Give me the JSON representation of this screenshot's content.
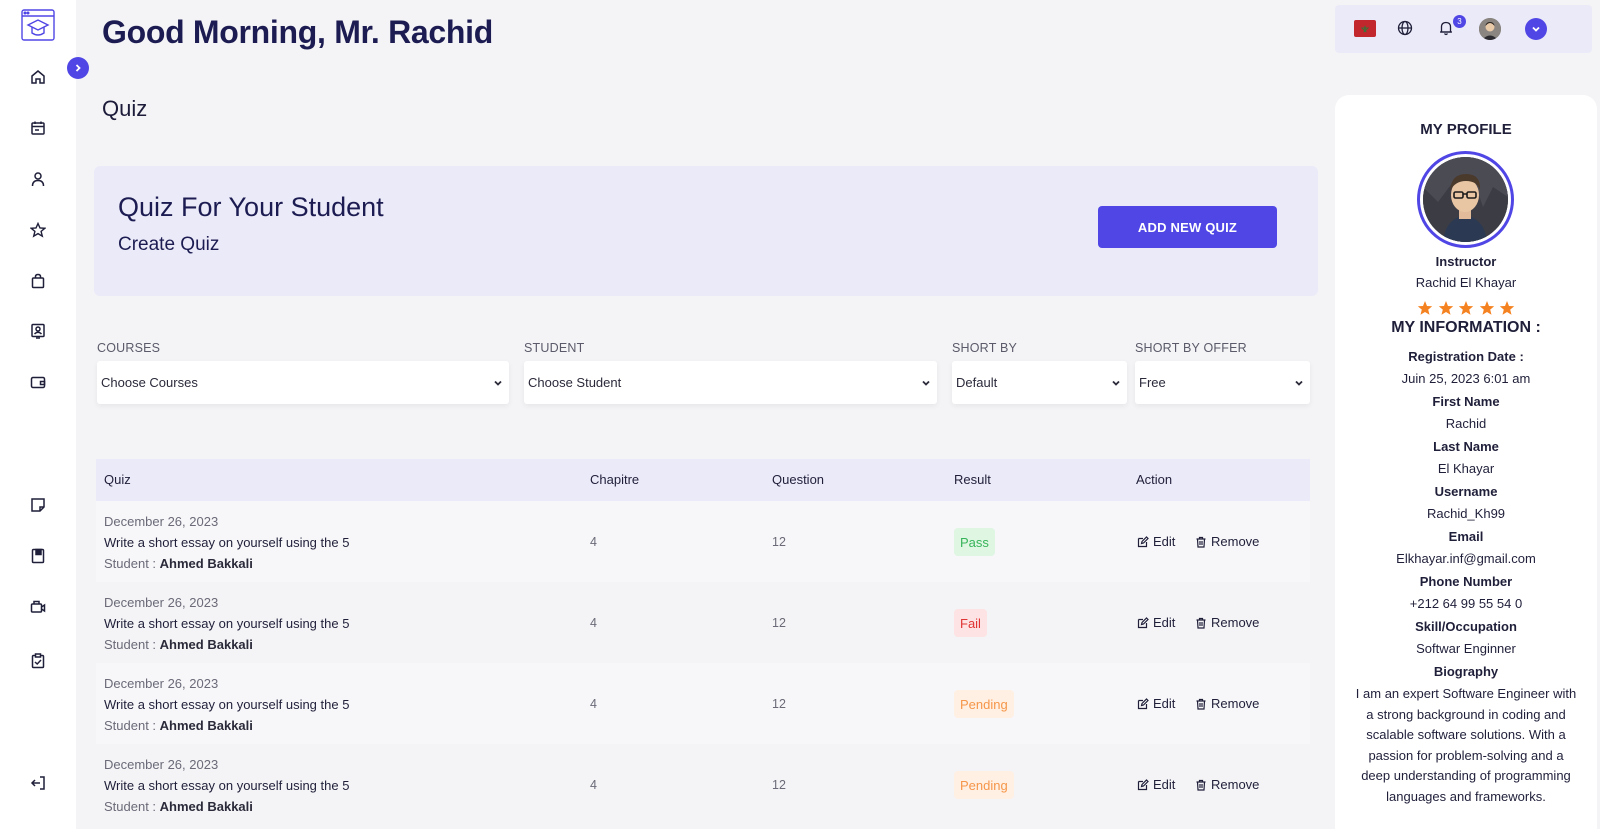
{
  "header": {
    "greeting": "Good Morning, Mr. Rachid",
    "page_title": "Quiz"
  },
  "sidebar": {
    "items": [
      {
        "icon": "home-icon"
      },
      {
        "icon": "calendar-icon"
      },
      {
        "icon": "user-icon"
      },
      {
        "icon": "star-icon"
      },
      {
        "icon": "shopping-bag-icon"
      },
      {
        "icon": "id-card-icon"
      },
      {
        "icon": "wallet-icon"
      },
      {
        "icon": "note-icon"
      },
      {
        "icon": "book-icon"
      },
      {
        "icon": "video-icon"
      },
      {
        "icon": "clipboard-check-icon"
      },
      {
        "icon": "logout-icon"
      }
    ]
  },
  "banner": {
    "title": "Quiz For Your Student",
    "subtitle": "Create Quiz",
    "button_label": "ADD NEW QUIZ"
  },
  "filters": [
    {
      "label": "COURSES",
      "value": "Choose Courses"
    },
    {
      "label": "STUDENT",
      "value": "Choose Student"
    },
    {
      "label": "SHORT BY",
      "value": "Default"
    },
    {
      "label": "SHORT BY OFFER",
      "value": "Free"
    }
  ],
  "table": {
    "headers": {
      "quiz": "Quiz",
      "chapitre": "Chapitre",
      "question": "Question",
      "result": "Result",
      "action": "Action"
    },
    "edit_label": "Edit",
    "remove_label": "Remove",
    "student_prefix": "Student :",
    "rows": [
      {
        "date": "December 26, 2023",
        "quiz": "Write a short essay on yourself using the 5",
        "student": "Ahmed Bakkali",
        "chapitre": "4",
        "question": "12",
        "result": "Pass",
        "status": "pass"
      },
      {
        "date": "December 26, 2023",
        "quiz": "Write a short essay on yourself using the 5",
        "student": "Ahmed Bakkali",
        "chapitre": "4",
        "question": "12",
        "result": "Fail",
        "status": "fail"
      },
      {
        "date": "December 26, 2023",
        "quiz": "Write a short essay on yourself using the 5",
        "student": "Ahmed Bakkali",
        "chapitre": "4",
        "question": "12",
        "result": "Pending",
        "status": "pending"
      },
      {
        "date": "December 26, 2023",
        "quiz": "Write a short essay on yourself using the 5",
        "student": "Ahmed Bakkali",
        "chapitre": "4",
        "question": "12",
        "result": "Pending",
        "status": "pending"
      }
    ]
  },
  "topbar": {
    "notification_count": "3"
  },
  "profile": {
    "heading": "MY PROFILE",
    "role": "Instructor",
    "name": "Rachid El Khayar",
    "rating": 5,
    "info_heading": "MY INFORMATION :",
    "fields": [
      {
        "label": "Registration Date :",
        "value": "Juin 25, 2023 6:01 am"
      },
      {
        "label": "First Name",
        "value": "Rachid"
      },
      {
        "label": "Last Name",
        "value": "El Khayar"
      },
      {
        "label": "Username",
        "value": "Rachid_Kh99"
      },
      {
        "label": "Email",
        "value": "Elkhayar.inf@gmail.com"
      },
      {
        "label": "Phone Number",
        "value": "+212 64 99 55 54 0"
      },
      {
        "label": "Skill/Occupation",
        "value": "Softwar Enginner"
      }
    ],
    "bio_label": "Biography",
    "bio": "I am an expert Software Engineer with a strong background in coding and scalable software solutions. With a passion for problem-solving and a deep understanding of programming languages and frameworks."
  },
  "colors": {
    "accent": "#5046e5",
    "pass": "#37b45a",
    "fail": "#e03434",
    "pending": "#f5964a",
    "star": "#f58220"
  }
}
